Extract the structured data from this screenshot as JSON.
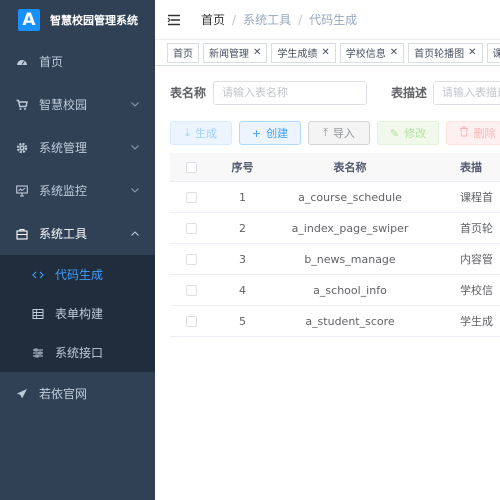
{
  "sidebar": {
    "logo_letter": "A",
    "title": "智慧校园管理系统",
    "items": [
      {
        "label": "首页"
      },
      {
        "label": "智慧校园"
      },
      {
        "label": "系统管理"
      },
      {
        "label": "系统监控"
      },
      {
        "label": "系统工具"
      }
    ],
    "submenu": [
      {
        "label": "代码生成"
      },
      {
        "label": "表单构建"
      },
      {
        "label": "系统接口"
      }
    ],
    "external": {
      "label": "若依官网"
    }
  },
  "navbar": {
    "breadcrumb": [
      "首页",
      "系统工具",
      "代码生成"
    ]
  },
  "tags": [
    {
      "label": "首页"
    },
    {
      "label": "新闻管理"
    },
    {
      "label": "学生成绩"
    },
    {
      "label": "学校信息"
    },
    {
      "label": "首页轮播图"
    },
    {
      "label": "课程"
    }
  ],
  "search": {
    "table_name_label": "表名称",
    "table_name_placeholder": "请输入表名称",
    "table_desc_label": "表描述",
    "table_desc_placeholder": "请输入表描述"
  },
  "toolbar": {
    "generate": "生成",
    "create": "创建",
    "import": "导入",
    "edit": "修改",
    "delete": "删除"
  },
  "table": {
    "columns": [
      "序号",
      "表名称",
      "表描"
    ],
    "rows": [
      {
        "index": "1",
        "name": "a_course_schedule",
        "desc": "课程首"
      },
      {
        "index": "2",
        "name": "a_index_page_swiper",
        "desc": "首页轮"
      },
      {
        "index": "3",
        "name": "b_news_manage",
        "desc": "内容管"
      },
      {
        "index": "4",
        "name": "a_school_info",
        "desc": "学校信"
      },
      {
        "index": "5",
        "name": "a_student_score",
        "desc": "学生成"
      }
    ]
  },
  "colors": {
    "sidebar_bg": "#304156",
    "submenu_bg": "#1f2d3d",
    "accent": "#409eff"
  }
}
